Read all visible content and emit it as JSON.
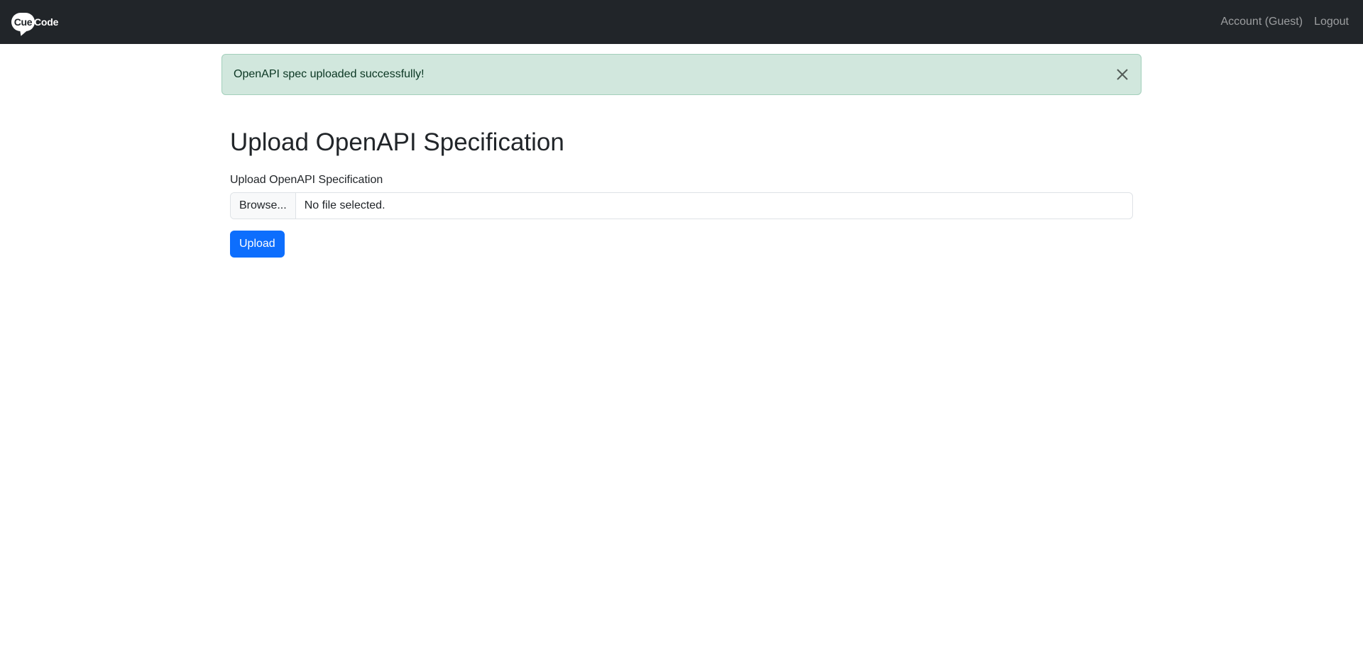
{
  "navbar": {
    "brand_part1": "Cue",
    "brand_part2": "Code",
    "links": [
      {
        "label": "Account (Guest)"
      },
      {
        "label": "Logout"
      }
    ]
  },
  "alert": {
    "message": "OpenAPI spec uploaded successfully!",
    "type": "success",
    "close_icon": "close-icon"
  },
  "main": {
    "title": "Upload OpenAPI Specification",
    "field_label": "Upload OpenAPI Specification",
    "file_input": {
      "button_label": "Browse...",
      "status": "No file selected."
    },
    "submit_label": "Upload"
  },
  "colors": {
    "navbar_bg": "#212529",
    "alert_bg": "#d1e7dd",
    "alert_border": "#a3cfbb",
    "alert_text": "#0a3622",
    "primary": "#0d6efd"
  }
}
